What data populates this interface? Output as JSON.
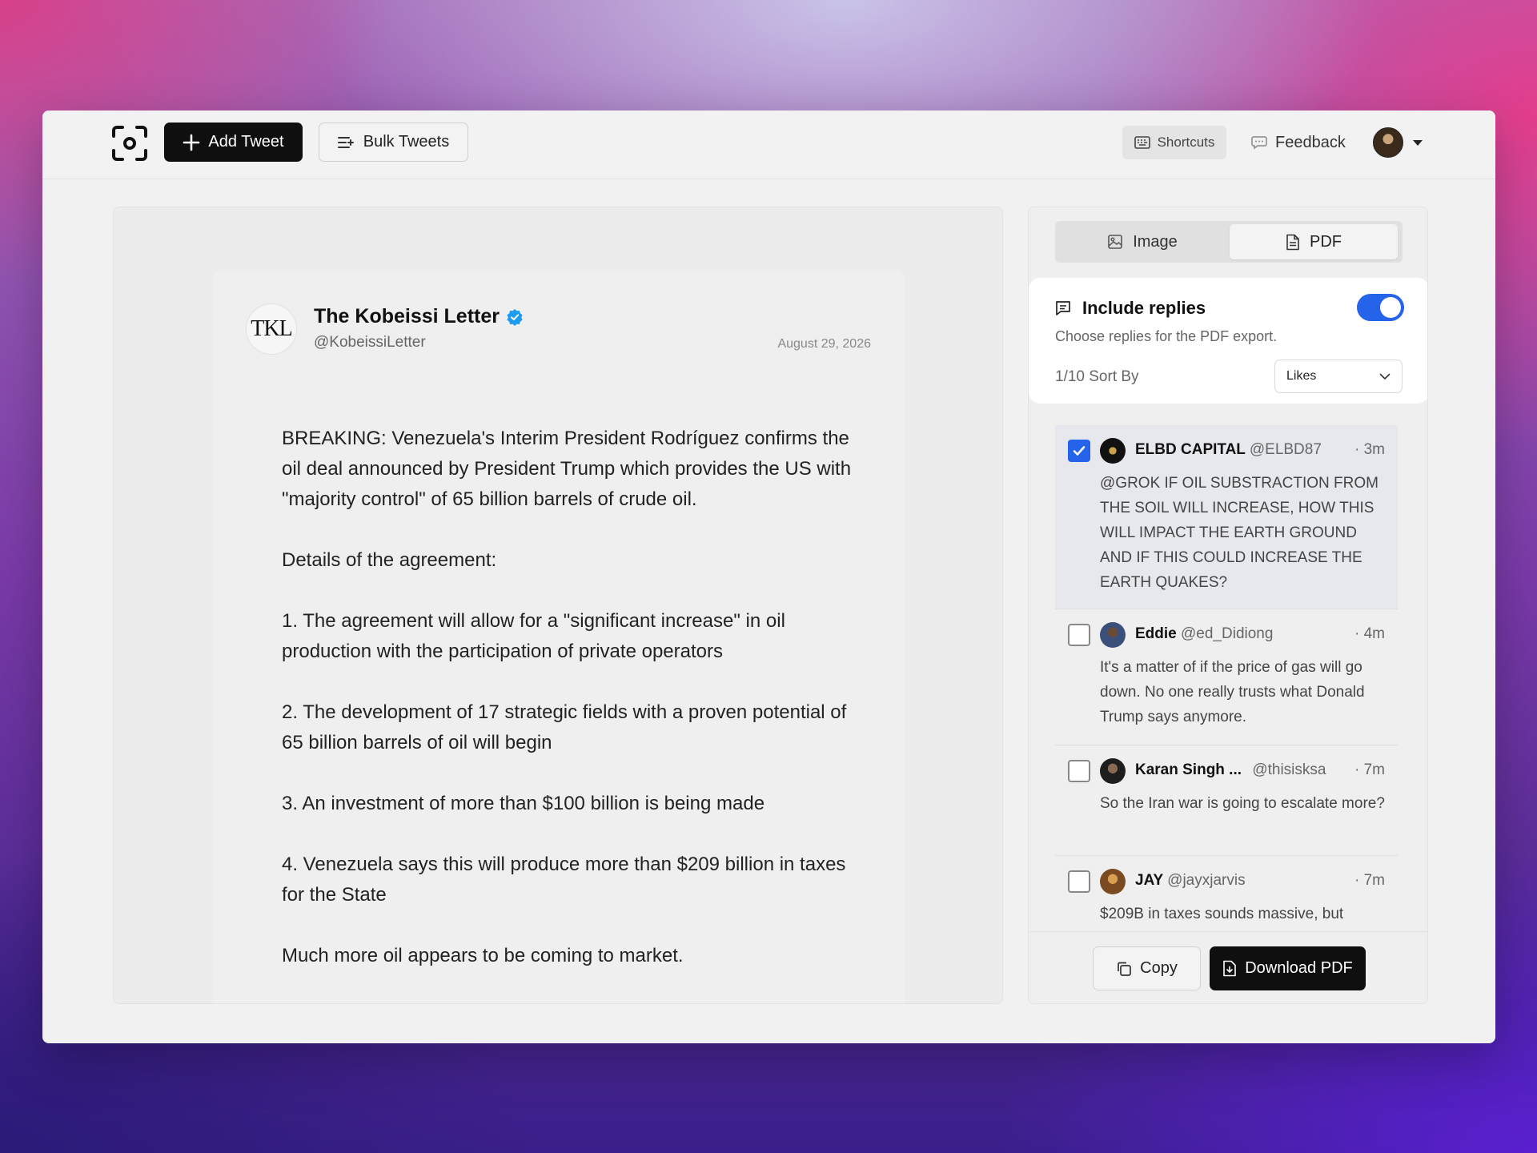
{
  "toolbar": {
    "add_tweet": "Add Tweet",
    "bulk_tweets": "Bulk Tweets",
    "shortcuts": "Shortcuts",
    "feedback": "Feedback"
  },
  "tweet": {
    "author_name": "The Kobeissi Letter",
    "author_handle": "@KobeissiLetter",
    "avatar_text": "TKL",
    "date": "August 29, 2026",
    "paragraphs": [
      "BREAKING: Venezuela's Interim President Rodríguez confirms the oil deal announced by President Trump which provides the US with \"majority control\" of 65 billion barrels of crude oil.",
      "Details of the agreement:",
      "1. The agreement will allow for a \"significant increase\" in oil production with the participation of private operators",
      "2. The development of 17 strategic fields with a proven potential of 65 billion barrels of oil will begin",
      "3. An investment of more than $100 billion is being made",
      "4. Venezuela says this will produce more than $209 billion in taxes for the State",
      "Much more oil appears to be coming to market."
    ]
  },
  "export": {
    "tab_image": "Image",
    "tab_pdf": "PDF",
    "include_replies": "Include replies",
    "include_replies_desc": "Choose replies for the PDF export.",
    "count": "1/10 Sort By",
    "sort_value": "Likes",
    "copy": "Copy",
    "download": "Download PDF"
  },
  "replies": [
    {
      "name": "ELBD CAPITAL",
      "handle": "@ELBD87",
      "time": "· 3m",
      "text": "@GROK IF OIL SUBSTRACTION FROM THE SOIL WILL INCREASE, HOW THIS WILL IMPACT THE EARTH GROUND AND IF THIS COULD INCREASE THE EARTH QUAKES?",
      "selected": true
    },
    {
      "name": "Eddie",
      "handle": "@ed_Didiong",
      "time": "· 4m",
      "text": "It's a matter of if the price of gas will go down. No one really trusts what Donald Trump says anymore.",
      "selected": false
    },
    {
      "name": "Karan Singh ...",
      "handle": "@thisisksa",
      "time": "· 7m",
      "text": "So the Iran war is going to escalate more?",
      "selected": false
    },
    {
      "name": "JAY",
      "handle": "@jayxjarvis",
      "time": "· 7m",
      "text": "$209B in taxes sounds massive, but",
      "selected": false
    }
  ],
  "colors": {
    "accent": "#2563eb",
    "verified": "#1d9bf0"
  }
}
